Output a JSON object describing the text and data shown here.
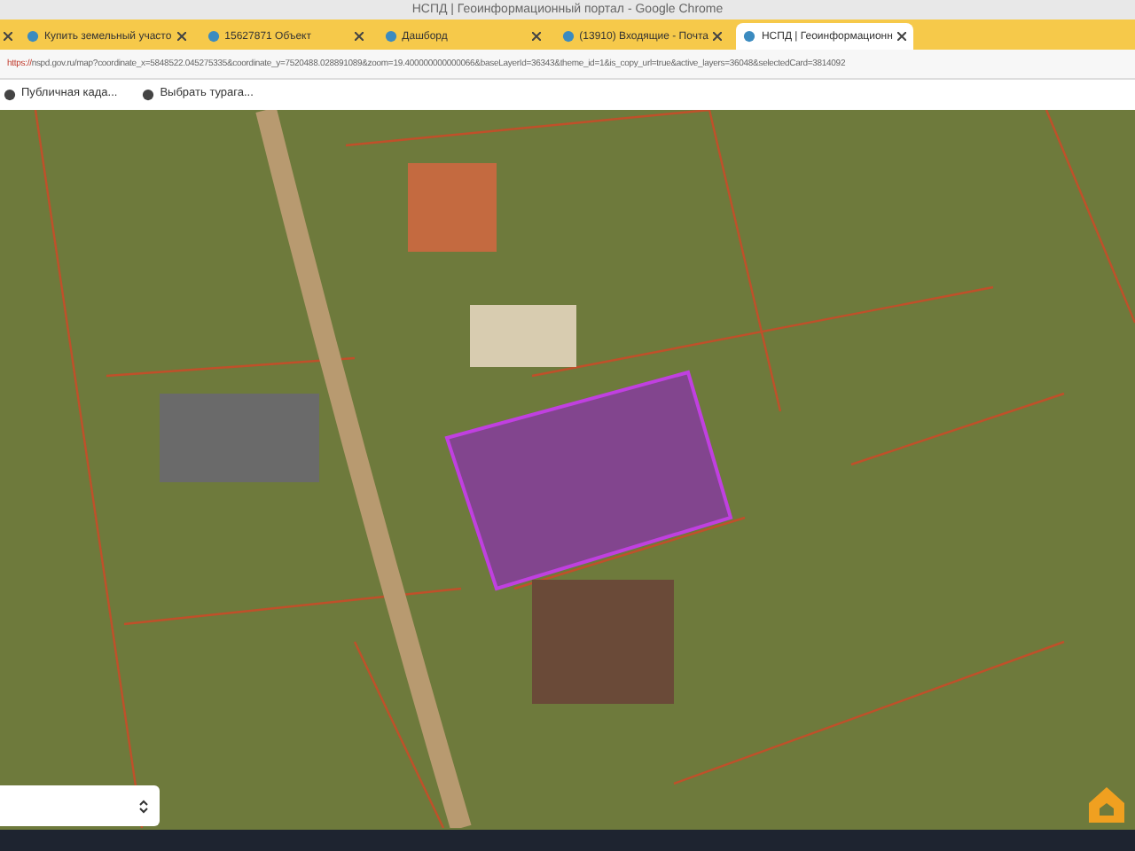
{
  "window": {
    "title": "НСПД | Геоинформационный портал - Google Chrome"
  },
  "tabs": [
    {
      "label": "Купить земельный участо",
      "selected": false
    },
    {
      "label": "15627871 Объект",
      "selected": false
    },
    {
      "label": "Дашборд",
      "selected": false
    },
    {
      "label": "(13910) Входящие - Почта",
      "selected": false
    },
    {
      "label": "НСПД | Геоинформационн",
      "selected": true
    }
  ],
  "address_bar": {
    "scheme": "https://",
    "url": "nspd.gov.ru/map?coordinate_x=5848522.045275335&coordinate_y=7520488.028891089&zoom=19.400000000000066&baseLayerId=36343&theme_id=1&is_copy_url=true&active_layers=36048&selectedCard=3814092"
  },
  "bookmarks": [
    {
      "label": "Публичная када..."
    },
    {
      "label": "Выбрать турага..."
    }
  ]
}
